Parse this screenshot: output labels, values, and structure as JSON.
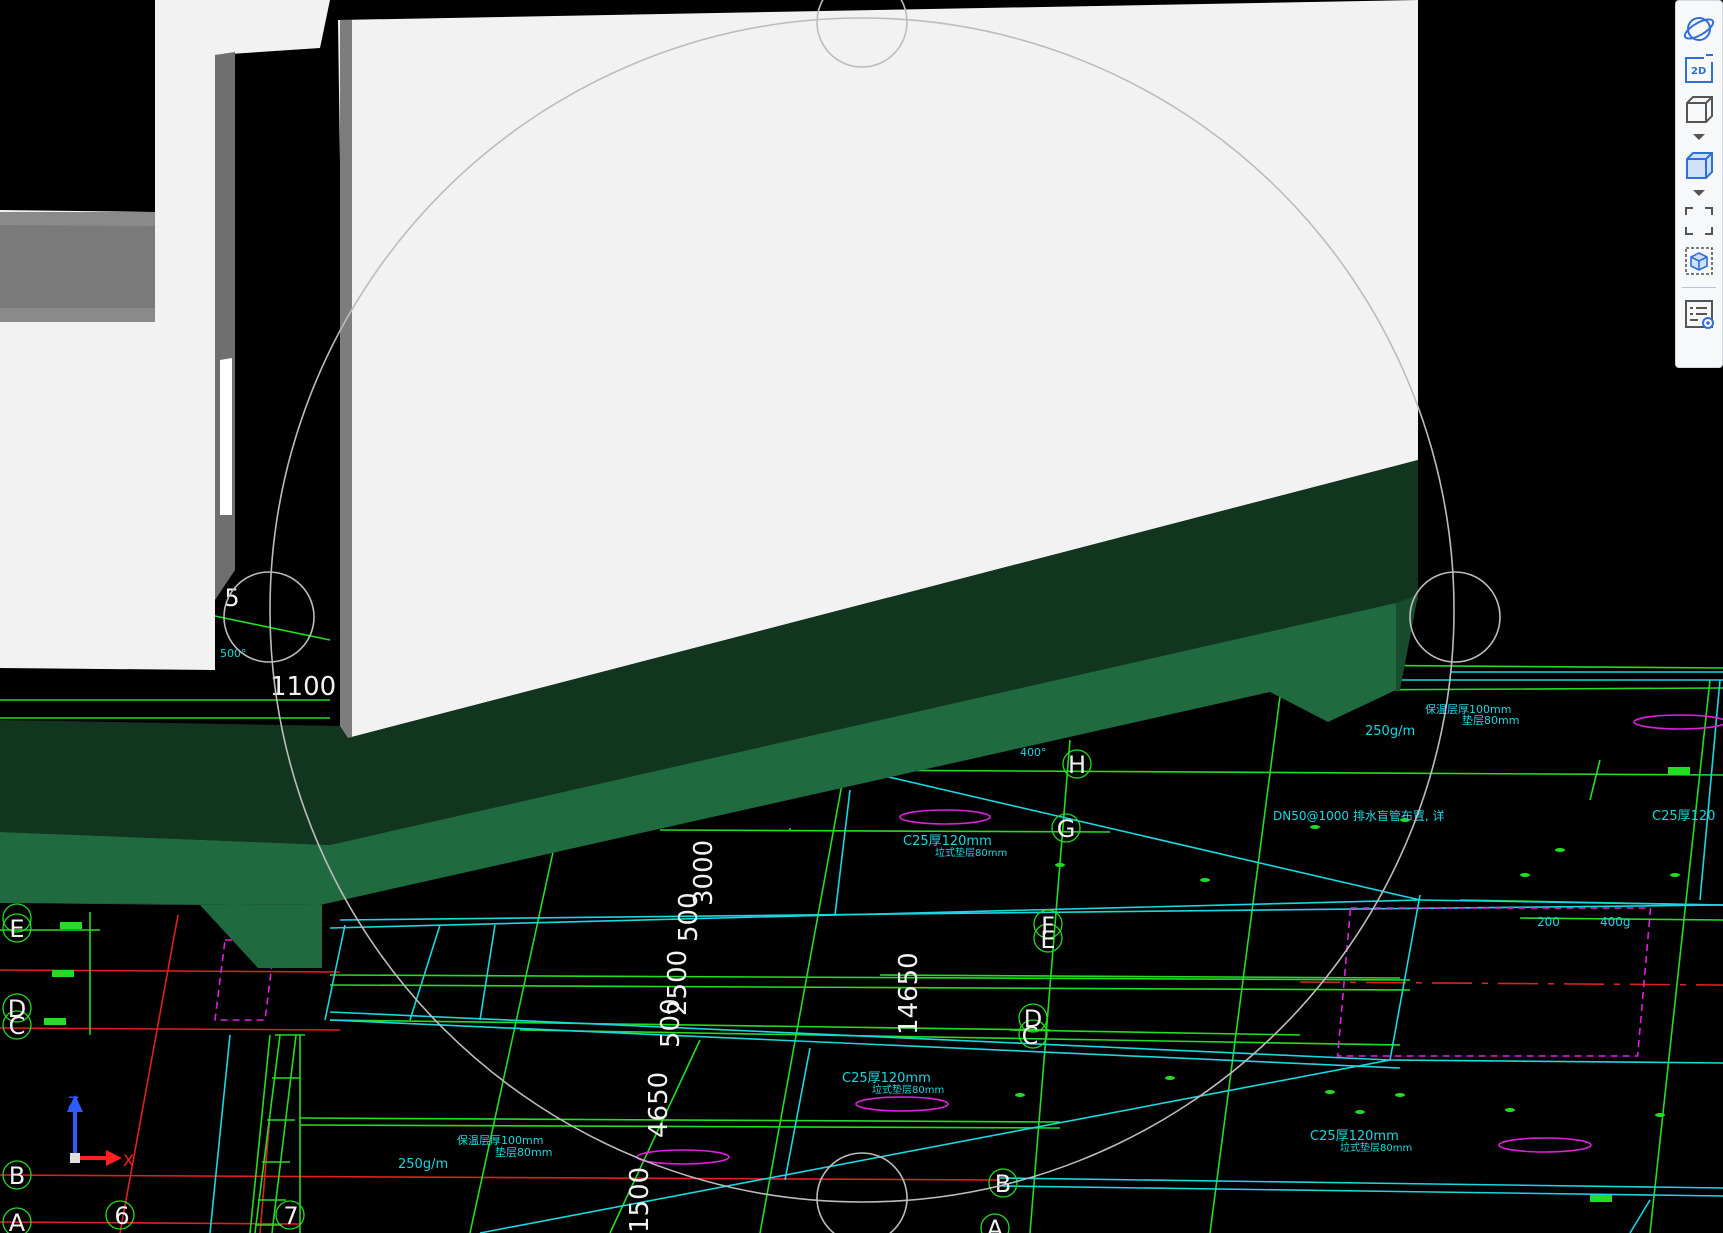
{
  "viewer": {
    "dimension_labels": {
      "d1100": "1100",
      "d3000": "3000",
      "d500a": "500",
      "d2500": "2500",
      "d500b": "500",
      "d14650": "14650",
      "d4650": "4650",
      "d1500": "1500"
    },
    "grid_labels": {
      "H": "H",
      "G": "G",
      "F": "F",
      "E1": "E",
      "E2": "E",
      "D1": "D",
      "C1": "C",
      "D2": "D",
      "C2": "C",
      "B1": "B",
      "B2": "B",
      "A1": "A",
      "A2": "A",
      "n5": "5",
      "n6": "6",
      "n7": "7"
    },
    "annotations": {
      "c25_a": "C25厚120mm",
      "c25_a_sub": "垃式垫层80mm",
      "c25_b": "C25厚120mm",
      "c25_b_sub": "垃式垫层80mm",
      "c25_c": "C25厚120mm",
      "c25_c_sub": "垃式垫层80mm",
      "c25_d": "C25厚120",
      "dn50": "DN50@1000 排水盲管布置, 详",
      "g250_a": "250g/m",
      "g250_b": "250g/m",
      "mm100_a": "保温层厚100mm",
      "mm80_a": "垫层80mm",
      "mm100_b": "保温层厚100mm",
      "mm80_b": "垫层80mm",
      "d200": "200",
      "d400": "400g",
      "d400b": "400°",
      "d500c": "500°"
    },
    "axis_triad": {
      "x": "X",
      "z": "Z"
    },
    "colors": {
      "background": "#000000",
      "wall_light": "#f2f2f2",
      "wall_gray": "#8a8a8a",
      "slab_dark": "#12351f",
      "slab_mid": "#1f6a3e",
      "cad_green": "#22dd22",
      "cad_cyan": "#18d8e0",
      "cad_red": "#e02020",
      "cad_magenta": "#e020e0",
      "orbit_ring": "#bcbcbc",
      "toolbar_icon": "#2f6fd8"
    }
  },
  "toolbar": {
    "items": [
      {
        "name": "orbit-icon",
        "active": true
      },
      {
        "name": "view-2d-icon",
        "label": "2D"
      },
      {
        "name": "view-3d-wire-icon",
        "has_dropdown": true
      },
      {
        "name": "view-3d-solid-icon",
        "has_dropdown": true
      },
      {
        "name": "fit-view-icon"
      },
      {
        "name": "section-box-icon"
      },
      {
        "name": "model-properties-icon"
      }
    ]
  }
}
